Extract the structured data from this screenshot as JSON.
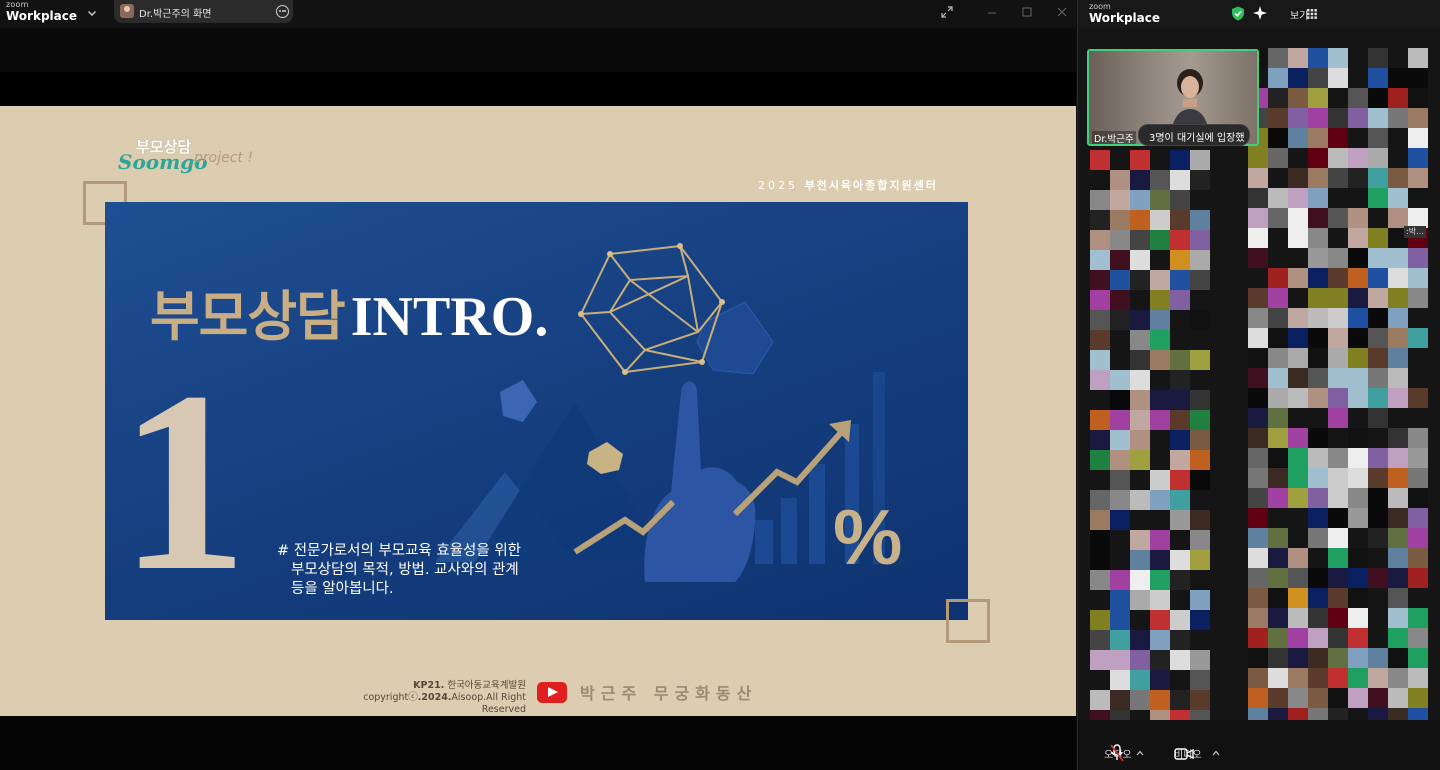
{
  "app": {
    "brand_small": "zoom",
    "brand_name": "Workplace"
  },
  "share_pill": {
    "label": "Dr.박근주의 화면"
  },
  "slide": {
    "logo_ko": "부모상담",
    "logo_en": "Soomgo",
    "logo_project": "project !",
    "center_year": "2025",
    "center_name": "부천시육아종합지원센터",
    "title_ko": "부모상담",
    "title_en": "INTRO.",
    "big_number": "1",
    "desc_line1": "# 전문가로서의 부모교육 효율성을 위한",
    "desc_line2": "부모상담의 목적, 방법. 교사와의 관계",
    "desc_line3": "등을 알아봅니다.",
    "footer_org_bold": "KP21.",
    "footer_org": "한국아동교육계발원",
    "footer_copyright": "copyright",
    "footer_year": ".2024.",
    "footer_rights": "Aisoop.All Right Reserved",
    "channel_name": "박근주 무궁화동산",
    "percent_symbol": "%"
  },
  "gallery": {
    "brand_small": "zoom",
    "brand_name": "Workplace",
    "view_label": "보기",
    "self_name": "Dr.박근주",
    "waiting_tooltip": "3명이 대기실에 입장했",
    "small_tag": ":박...",
    "mic_label": "오디오",
    "video_label": "비디오"
  },
  "colors": {
    "slide_bg": "#dcccb0",
    "panel_blue": "#164081",
    "title_gold": "#c9ad84",
    "accent_teal": "#2fa59a",
    "active_speaker": "#3fd07a",
    "youtube_red": "#e02020"
  }
}
